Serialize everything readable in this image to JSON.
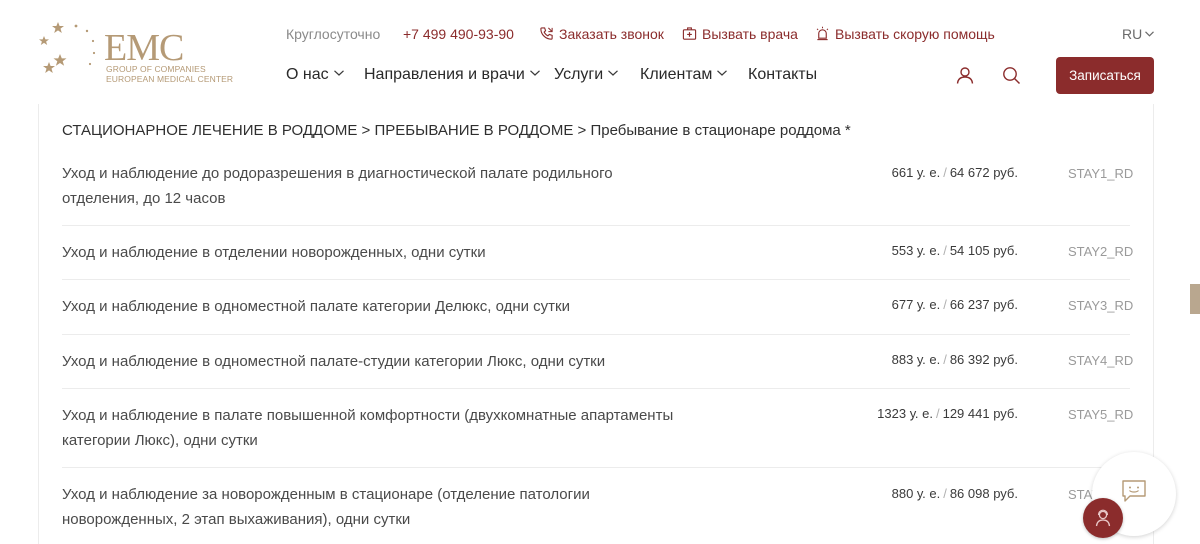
{
  "brand": {
    "logo_text": "EMC",
    "sub_line1": "GROUP OF COMPANIES",
    "sub_line2": "EUROPEAN MEDICAL CENTER",
    "accent_gold": "#b59a76",
    "accent_red": "#8b2c2c"
  },
  "topbar": {
    "hours": "Круглосуточно",
    "phone": "+7 499 490-93-90",
    "callback": "Заказать звонок",
    "doctor": "Вызвать врача",
    "ambulance": "Вызвать скорую помощь",
    "lang": "RU"
  },
  "nav": {
    "items": [
      {
        "label": "О нас"
      },
      {
        "label": "Направления и врачи"
      },
      {
        "label": "Услуги"
      },
      {
        "label": "Клиентам"
      },
      {
        "label": "Контакты"
      }
    ],
    "cta": "Записаться"
  },
  "breadcrumb": "СТАЦИОНАРНОЕ ЛЕЧЕНИЕ В РОДДОМЕ > ПРЕБЫВАНИЕ В РОДДОМЕ > Пребывание в стационаре роддома *",
  "services": [
    {
      "name_l1": "Уход и наблюдение до родоразрешения в диагностической палате родильного",
      "name_l2": "отделения, до 12 часов",
      "usd": "661 у. е.",
      "rub": "64 672 руб.",
      "code": "STAY1_RD"
    },
    {
      "name_l1": "Уход и наблюдение в отделении новорожденных, одни сутки",
      "name_l2": "",
      "usd": "553 у. е.",
      "rub": "54 105 руб.",
      "code": "STAY2_RD"
    },
    {
      "name_l1": "Уход и наблюдение в одноместной палате категории Делюкс, одни сутки",
      "name_l2": "",
      "usd": "677 у. е.",
      "rub": "66 237 руб.",
      "code": "STAY3_RD"
    },
    {
      "name_l1": "Уход и наблюдение в одноместной палате-студии категории Люкс, одни сутки",
      "name_l2": "",
      "usd": "883 у. е.",
      "rub": "86 392 руб.",
      "code": "STAY4_RD"
    },
    {
      "name_l1": "Уход и наблюдение в палате повышенной комфортности (двухкомнатные апартаменты",
      "name_l2": "категории Люкс), одни сутки",
      "usd": "1323 у. е.",
      "rub": "129 441 руб.",
      "code": "STAY5_RD"
    },
    {
      "name_l1": "Уход и наблюдение за новорожденным в стационаре (отделение патологии",
      "name_l2": "новорожденных, 2 этап выхаживания), одни сутки",
      "usd": "880 у. е.",
      "rub": "86 098 руб.",
      "code": "STAY"
    }
  ],
  "price_separator": "/"
}
